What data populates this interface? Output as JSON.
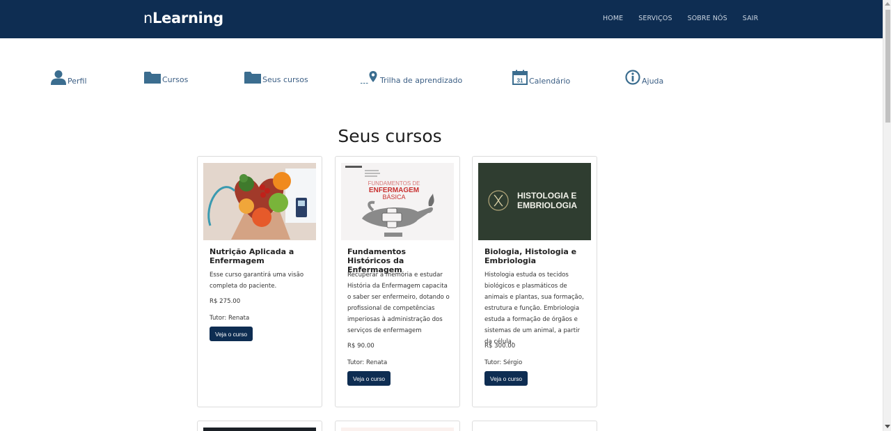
{
  "navbar": {
    "brand_prefix": "n",
    "brand_main": "Learning",
    "links": [
      "HOME",
      "SERVIÇOS",
      "SOBRE NÓS",
      "SAIR"
    ]
  },
  "menu": [
    {
      "label": "Perfil",
      "icon": "user-icon"
    },
    {
      "label": "Cursos",
      "icon": "folder-icon"
    },
    {
      "label": "Seus cursos",
      "icon": "folder-icon"
    },
    {
      "label": "Trilha de aprendizado",
      "icon": "map-pin-icon"
    },
    {
      "label": "Calendário",
      "icon": "calendar-icon",
      "icon_text": "31"
    },
    {
      "label": "Ajuda",
      "icon": "info-icon"
    }
  ],
  "page_title": "Seus cursos",
  "courses": [
    {
      "title": "Nutrição Aplicada a Enfermagem",
      "description": "Esse curso garantirá uma visão completa do paciente.",
      "price": "R$ 275.00",
      "tutor": "Tutor: Renata",
      "button": "Veja o curso",
      "image": "heart-shaped-bowl-with-fruits-and-stethoscope"
    },
    {
      "title": "Fundamentos Históricos da Enfermagem",
      "description": "Recuperar a memória e estudar História da Enfermagem capacita o saber ser enfermeiro, dotando o profissional de competências imperiosas à administração dos serviços de enfermagem",
      "price": "R$ 90.00",
      "tutor": "Tutor: Renata",
      "button": "Veja o curso",
      "image": "book-cover-with-nursing-lamp",
      "image_text": [
        "FUNDAMENTOS DE",
        "ENFERMAGEM",
        "BÁSICA"
      ]
    },
    {
      "title": "Biologia, Histologia e Embriologia",
      "description": "Histologia estuda os tecidos biológicos e plasmáticos de animais e plantas, sua formação, estrutura e função. Embriologia estuda a formação de órgãos e sistemas de um animal, a partir da célula.",
      "price": "R$ 300.00",
      "tutor": "Tutor: Sérgio",
      "button": "Veja o curso",
      "image": "dna-badge-banner",
      "image_text": [
        "HISTOLOGIA E",
        "EMBRIOLOGIA"
      ]
    }
  ],
  "colors": {
    "navbar": "#0e2d52",
    "accent_icon": "#3b6d8f",
    "button": "#0e2d52",
    "histology_bg": "#2f3d30"
  }
}
